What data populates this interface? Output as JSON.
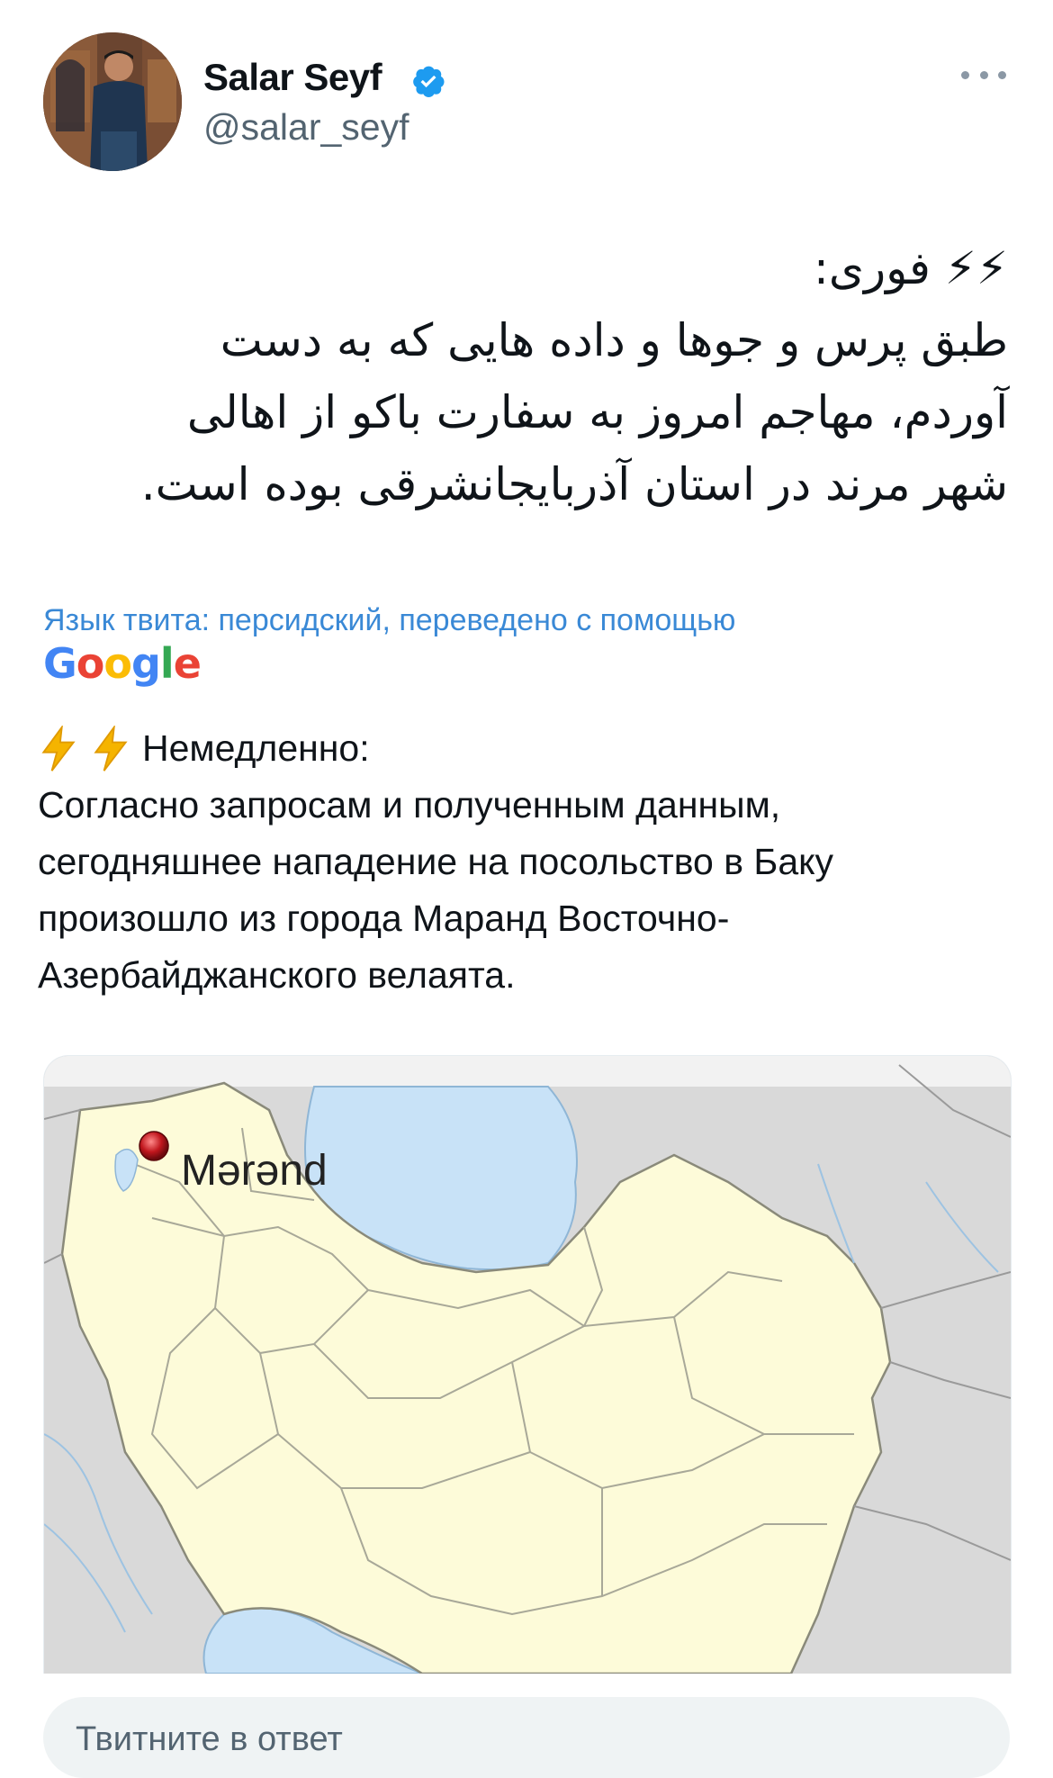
{
  "author": {
    "display_name": "Salar Seyf",
    "handle": "@salar_seyf",
    "verified": true
  },
  "tweet": {
    "persian_lines": [
      "⚡⚡ فوری:",
      "طبق پرس و جوها و داده هایی که به دست",
      "آوردم، مهاجم امروز به سفارت باکو از اهالی",
      "شهر مرند در استان آذربایجانشرقی بوده است."
    ],
    "translation_note": "Язык твита: персидский, переведено с помощью",
    "translation_provider": "Google",
    "translated_heading": "Немедленно:",
    "translated_lines": [
      "Согласно запросам и полученным данным,",
      "сегодняшнее нападение на посольство в Баку",
      "произошло из города Маранд Восточно-",
      "Азербайджанского велаята."
    ]
  },
  "media": {
    "type": "map",
    "marker_label": "Mərənd",
    "colors": {
      "land_iran": "#fdfbd9",
      "land_other": "#d9d9d9",
      "water": "#c8e2f7",
      "border": "#9a9a8a",
      "marker": "#c0161d"
    }
  },
  "reply": {
    "placeholder": "Твитните в ответ"
  },
  "colors": {
    "link": "#3a89d6",
    "secondary_text": "#536471",
    "verified_blue": "#1d9bf0",
    "bolt_yellow": "#f5b400"
  },
  "icons": [
    "verified-badge-icon",
    "more-icon",
    "lightning-icon",
    "map-marker-icon"
  ]
}
